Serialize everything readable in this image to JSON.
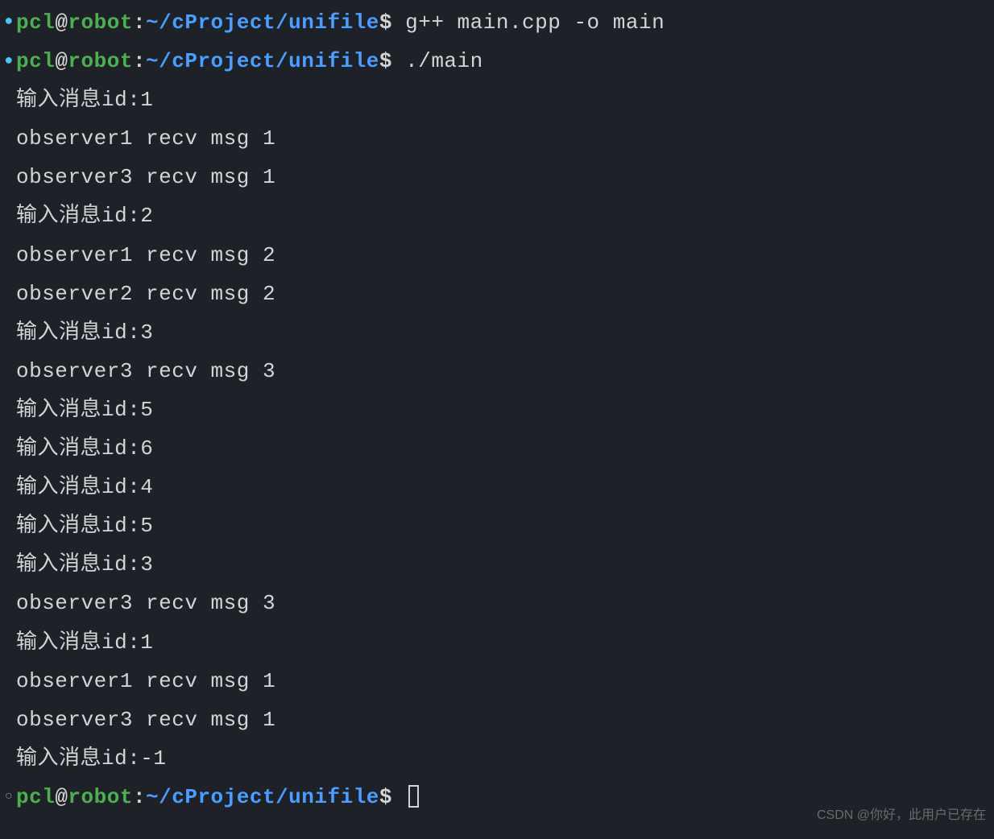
{
  "prompt": {
    "user": "pcl",
    "host": "robot",
    "path": "~/cProject/unifile",
    "symbol": "$"
  },
  "lines": [
    {
      "type": "prompt",
      "bullet": "filled",
      "command": "g++ main.cpp -o main"
    },
    {
      "type": "prompt",
      "bullet": "filled",
      "command": "./main"
    },
    {
      "type": "output",
      "text": "输入消息id:1"
    },
    {
      "type": "output",
      "text": "observer1 recv msg 1"
    },
    {
      "type": "output",
      "text": "observer3 recv msg 1"
    },
    {
      "type": "output",
      "text": "输入消息id:2"
    },
    {
      "type": "output",
      "text": "observer1 recv msg 2"
    },
    {
      "type": "output",
      "text": "observer2 recv msg 2"
    },
    {
      "type": "output",
      "text": "输入消息id:3"
    },
    {
      "type": "output",
      "text": "observer3 recv msg 3"
    },
    {
      "type": "output",
      "text": "输入消息id:5"
    },
    {
      "type": "output",
      "text": "输入消息id:6"
    },
    {
      "type": "output",
      "text": "输入消息id:4"
    },
    {
      "type": "output",
      "text": "输入消息id:5"
    },
    {
      "type": "output",
      "text": "输入消息id:3"
    },
    {
      "type": "output",
      "text": "observer3 recv msg 3"
    },
    {
      "type": "output",
      "text": "输入消息id:1"
    },
    {
      "type": "output",
      "text": "observer1 recv msg 1"
    },
    {
      "type": "output",
      "text": "observer3 recv msg 1"
    },
    {
      "type": "output",
      "text": "输入消息id:-1"
    },
    {
      "type": "prompt",
      "bullet": "hollow",
      "command": "",
      "cursor": true
    }
  ],
  "watermark": "CSDN @你好，此用户已存在"
}
